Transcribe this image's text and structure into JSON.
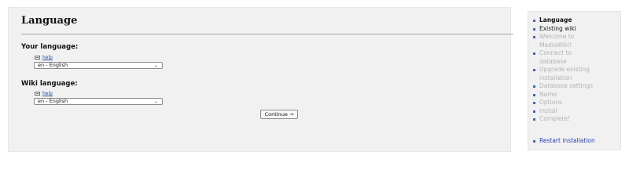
{
  "main": {
    "title": "Language",
    "your_language": {
      "label": "Your language:",
      "help": "help",
      "selected": "en - English"
    },
    "wiki_language": {
      "label": "Wiki language:",
      "help": "help",
      "selected": "en - English"
    },
    "continue_label": "Continue →"
  },
  "sidebar": {
    "steps": [
      {
        "label": "Language",
        "state": "current"
      },
      {
        "label": "Existing wiki",
        "state": "active"
      },
      {
        "label": "Welcome to",
        "state": "inactive"
      },
      {
        "label": "MediaWiki!",
        "state": "inactive"
      },
      {
        "label": "Connect to",
        "state": "inactive"
      },
      {
        "label": "database",
        "state": "inactive"
      },
      {
        "label": "Upgrade existing",
        "state": "inactive"
      },
      {
        "label": "installation",
        "state": "inactive"
      },
      {
        "label": "Database settings",
        "state": "inactive"
      },
      {
        "label": "Name",
        "state": "inactive"
      },
      {
        "label": "Options",
        "state": "inactive"
      },
      {
        "label": "Install",
        "state": "inactive"
      },
      {
        "label": "Complete!",
        "state": "inactive"
      }
    ],
    "restart_label": "Restart installation"
  },
  "colors": {
    "panel_bg": "#f1f1f1",
    "link": "#2a4b9a",
    "bullet": "#3f67b3",
    "inactive_text": "#b3b3b3"
  },
  "icons": {
    "help": "help-icon",
    "select": "chevron-down-icon",
    "bullet": "bullet-icon"
  }
}
